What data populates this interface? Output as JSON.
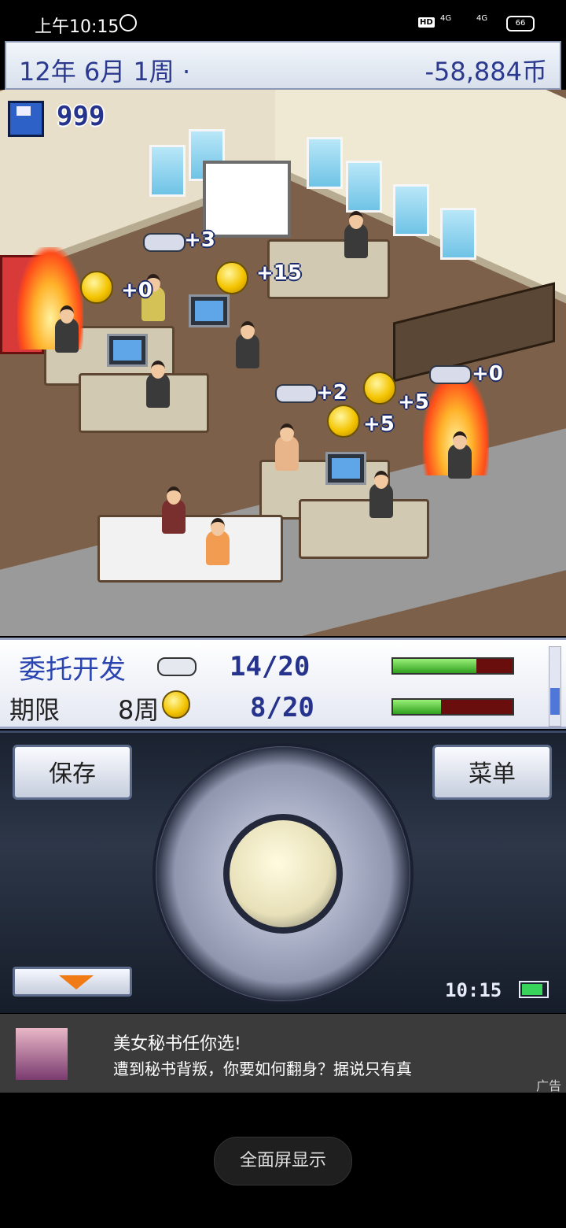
{
  "status_bar": {
    "time": "上午10:15",
    "hd": "HD",
    "signal1": "4G",
    "signal2": "4G",
    "battery": "66"
  },
  "top_bar": {
    "date": "12年 6月 1周 ·",
    "money": "-58,884币"
  },
  "scene": {
    "save_count": "999",
    "popups": [
      "+3",
      "+0",
      "+15",
      "+0",
      "+2",
      "+5",
      "+5"
    ]
  },
  "project": {
    "title": "委托开发",
    "deadline_label": "期限",
    "deadline_weeks": "8周",
    "fun_progress": "14/20",
    "fun_fraction": 0.7,
    "coin_progress": "8/20",
    "coin_fraction": 0.4,
    "bar_fill_color": "#2fa01e",
    "bar_empty_color": "#6a0d0d"
  },
  "controls": {
    "save": "保存",
    "menu": "菜单",
    "clock": "10:15"
  },
  "ad": {
    "title": "美女秘书任你选!",
    "description": "遭到秘书背叛，你要如何翻身？据说只有真",
    "tag": "广告"
  },
  "fullscreen_button": "全面屏显示"
}
